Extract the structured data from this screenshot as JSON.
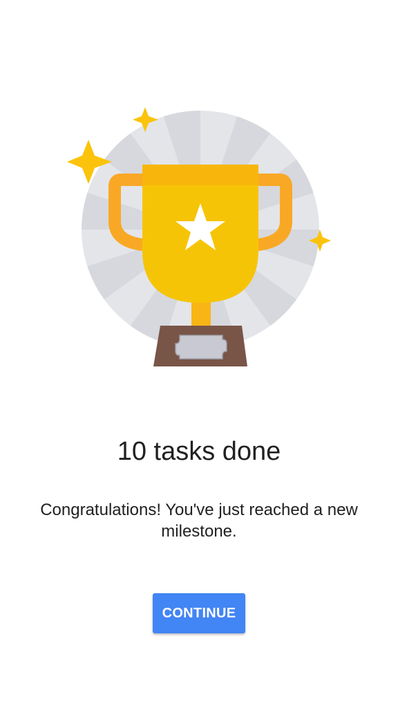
{
  "milestone": {
    "title": "10 tasks done",
    "message": "Congratulations! You've just reached a new milestone.",
    "button_label": "CONTINUE"
  },
  "illustration": {
    "icon": "trophy-icon",
    "colors": {
      "trophy_gold": "#f6c406",
      "trophy_handle": "#f9a825",
      "base": "#795548",
      "plate": "#c8c9d2",
      "burst_circle": "#e3e5e9",
      "sparkle": "#fbc30b"
    }
  },
  "theme": {
    "accent": "#4285f4",
    "background": "#ffffff",
    "text": "#212121"
  }
}
